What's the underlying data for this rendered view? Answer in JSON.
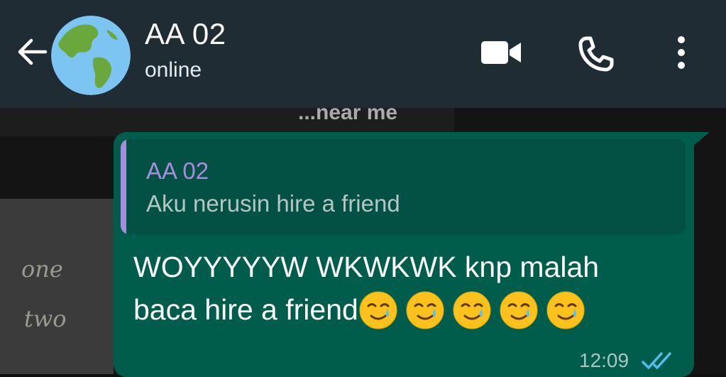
{
  "header": {
    "contact_name": "AA 02",
    "status": "online",
    "icons": [
      "back-arrow-icon",
      "avatar-globe",
      "video-call-icon",
      "phone-icon",
      "more-options-icon"
    ]
  },
  "wallpaper": {
    "board_text": "...near me",
    "handwriting": [
      "one",
      "two"
    ]
  },
  "message": {
    "quoted_name": "AA 02",
    "quoted_text": "Aku nerusin hire a friend",
    "text_line1": "WOYYYYYW WKWKWK knp malah",
    "text_line2": "baca hire a friend",
    "emoji_count": 5,
    "time": "12:09",
    "read_status": "read"
  },
  "colors": {
    "header_bg": "#1f2c34",
    "bubble_bg": "#005c4b",
    "quote_accent": "#a88ce0",
    "tick_color": "#53bdeb"
  }
}
